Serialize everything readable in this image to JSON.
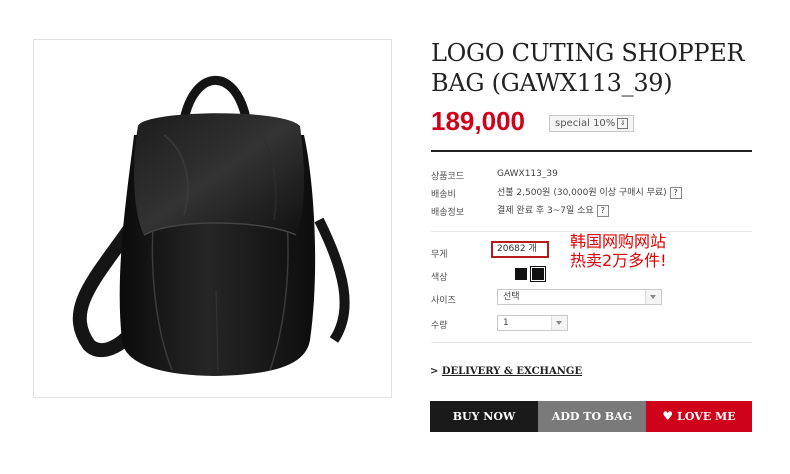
{
  "product": {
    "title_line1": "LOGO CUTING SHOPPER",
    "title_line2": "BAG (GAWX113_39)",
    "price": "189,000",
    "special_label": "special 10%",
    "download_glyph": "⇓"
  },
  "info": {
    "code_label": "상품코드",
    "code_value": "GAWX113_39",
    "shipping_label": "배송비",
    "shipping_value": "선불 2,500원 (30,000원 이상 구매시 무료)",
    "ship_info_label": "배송정보",
    "ship_info_value": "결제 완료 후 3~7일 소요",
    "help_glyph": "?"
  },
  "options": {
    "weight_label": "무게",
    "stock_value": "20682 개",
    "color_label": "색상",
    "colors": [
      "#111111",
      "#111111"
    ],
    "size_label": "사이즈",
    "size_value": "선택",
    "qty_label": "수량",
    "qty_value": "1"
  },
  "promo": {
    "line1": "韩国网购网站",
    "line2": "热卖2万多件!"
  },
  "delivery": {
    "prefix": ">",
    "label": "DELIVERY & EXCHANGE"
  },
  "buttons": {
    "buy": "BUY NOW",
    "bag": "ADD TO BAG",
    "love": "LOVE ME",
    "love_glyph": "♥"
  },
  "image": {
    "subject": "black leather backpack"
  }
}
